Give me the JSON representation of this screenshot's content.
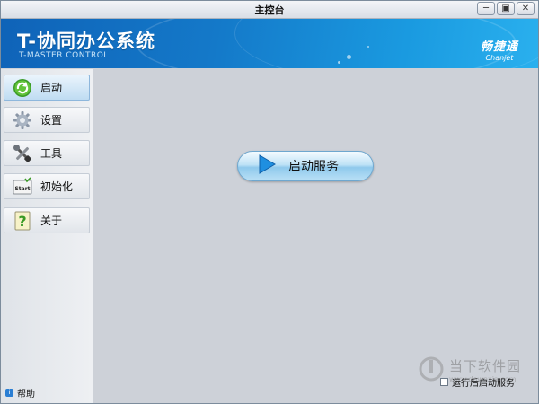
{
  "window": {
    "title": "主控台",
    "controls": {
      "minimize": "─",
      "restore": "▣",
      "close": "✕"
    }
  },
  "banner": {
    "app_title": "T-协同办公系统",
    "app_subtitle": "T-MASTER CONTROL",
    "brand_cn": "畅捷通",
    "brand_en": "Chanjet"
  },
  "sidebar": {
    "items": [
      {
        "label": "启动",
        "icon": "refresh-icon",
        "active": true
      },
      {
        "label": "设置",
        "icon": "gear-icon",
        "active": false
      },
      {
        "label": "工具",
        "icon": "tools-icon",
        "active": false
      },
      {
        "label": "初始化",
        "icon": "start-icon",
        "active": false
      },
      {
        "label": "关于",
        "icon": "question-icon",
        "active": false
      }
    ],
    "help_label": "帮助",
    "start_icon_text": "Start"
  },
  "main": {
    "start_button_label": "启动服务",
    "run_after_label": "运行后启动服务",
    "run_after_checked": false
  },
  "watermark": {
    "text": "当下软件园",
    "url": "www.downxia.com"
  },
  "colors": {
    "banner_start": "#0f63b8",
    "banner_end": "#2ab0ee",
    "main_bg": "#cdd1d8",
    "active_item": "#bfdcf2"
  }
}
